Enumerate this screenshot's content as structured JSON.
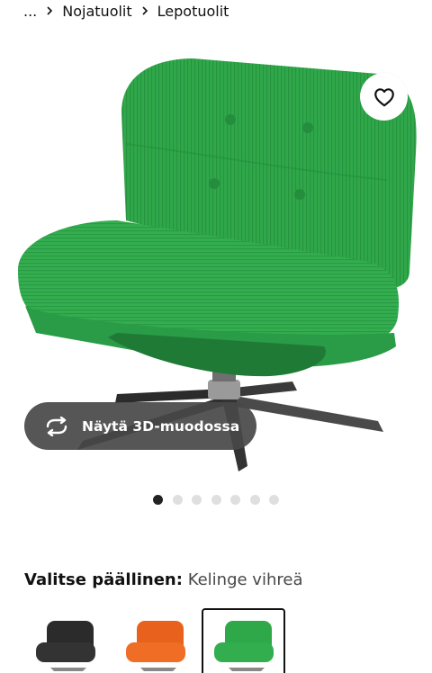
{
  "breadcrumb": {
    "items": [
      "...",
      "Nojatuolit",
      "Lepotuolit"
    ]
  },
  "product_image": {
    "alt": "DYVLINGE pyörivä nojatuoli, Kelinge vihreä",
    "color": "#2fa84a"
  },
  "favourite": {
    "icon": "heart-outline-icon"
  },
  "view3d": {
    "label": "Näytä 3D-muodossa",
    "icon": "rotate-arrows-icon"
  },
  "gallery": {
    "dot_count": 7,
    "active_index": 0
  },
  "cover": {
    "label": "Valitse päällinen:",
    "value": "Kelinge vihreä",
    "swatches": [
      {
        "name": "Kelinge musta",
        "color": "#2b2b2b",
        "selected": false
      },
      {
        "name": "Kelinge oranssi",
        "color": "#e8621d",
        "selected": false
      },
      {
        "name": "Kelinge vihreä",
        "color": "#2fa84a",
        "selected": true
      }
    ]
  }
}
